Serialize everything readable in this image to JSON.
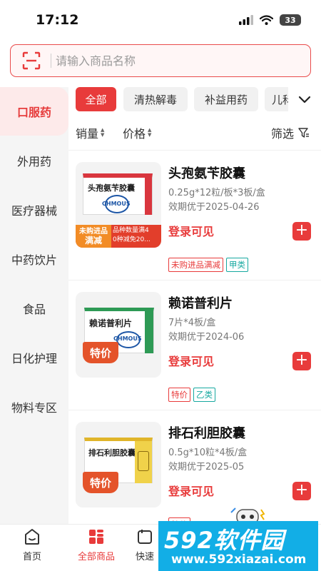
{
  "status_bar": {
    "time": "17:12",
    "battery": "33"
  },
  "search": {
    "placeholder": "请输入商品名称"
  },
  "sidebar": {
    "items": [
      {
        "label": "口服药",
        "active": true
      },
      {
        "label": "外用药"
      },
      {
        "label": "医疗器械"
      },
      {
        "label": "中药饮片"
      },
      {
        "label": "食品"
      },
      {
        "label": "日化护理"
      },
      {
        "label": "物料专区"
      }
    ]
  },
  "filter_tabs": [
    "全部",
    "清热解毒",
    "补益用药",
    "儿科"
  ],
  "sort": {
    "sales": "销量",
    "price": "价格",
    "filter": "筛选"
  },
  "products": [
    {
      "name": "头孢氨苄胶囊",
      "spec": "0.25g*12粒/板*3板/盒",
      "expiry": "效期优于2025-04-26",
      "price_text": "登录可见",
      "tags": [
        "未购进品满减",
        "甲类"
      ],
      "box_title": "头孢氨苄胶囊",
      "brand": "CHMOUS",
      "promo_label_1": "未购进品",
      "promo_label_2": "满减",
      "promo_text_1": "品种数量满4",
      "promo_text_2": "0种减免20..."
    },
    {
      "name": "赖诺普利片",
      "spec": "7片*4板/盒",
      "expiry": "效期优于2024-06",
      "price_text": "登录可见",
      "tags": [
        "特价",
        "乙类"
      ],
      "box_title": "赖诺普利片",
      "brand": "CHMOUS",
      "badge": "特价"
    },
    {
      "name": "排石利胆胶囊",
      "spec": "0.5g*10粒*4板/盒",
      "expiry": "效期优于2025-05",
      "price_text": "登录可见",
      "tags": [
        "特价"
      ],
      "box_title": "排石利胆胶囊",
      "badge": "特价"
    }
  ],
  "bottom_nav": [
    {
      "label": "首页",
      "icon": "home-icon"
    },
    {
      "label": "全部商品",
      "icon": "grid-icon",
      "active": true
    },
    {
      "label": "快速",
      "icon": "cart-icon"
    }
  ],
  "watermark": {
    "big": "592软件园",
    "small": "www.592xiazai.com"
  },
  "colors": {
    "accent": "#e83b3b",
    "teal": "#16a8a0",
    "watermark": "#12aee6"
  }
}
